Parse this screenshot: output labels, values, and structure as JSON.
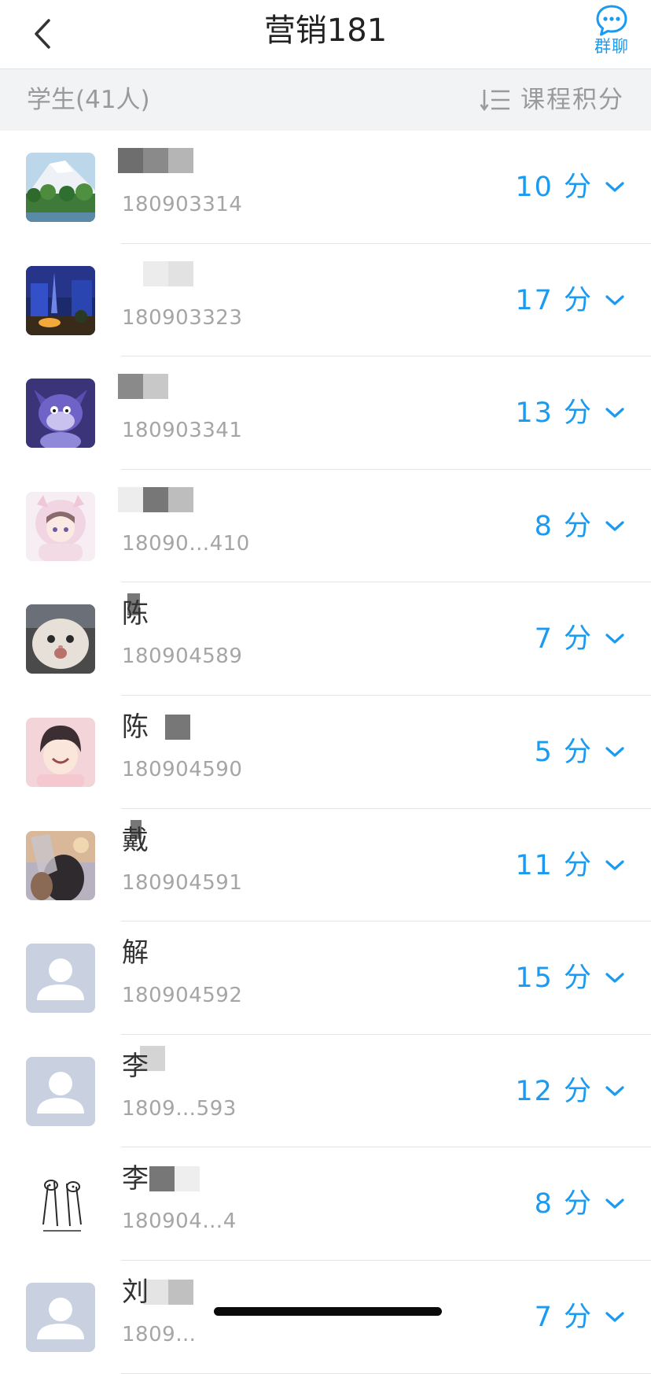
{
  "nav": {
    "title": "营销181",
    "chat_label": "群聊"
  },
  "subheader": {
    "count_label": "学生(41人)",
    "sort_label": "课程积分"
  },
  "students": [
    {
      "name": "",
      "id": "180903314",
      "score": "10 分",
      "avatar": "mountain"
    },
    {
      "name": "",
      "id": "180903323",
      "score": "17 分",
      "avatar": "night-city"
    },
    {
      "name": "",
      "id": "180903341",
      "score": "13 分",
      "avatar": "cartoon-cat"
    },
    {
      "name": "",
      "id": "18090…410",
      "score": "8 分",
      "avatar": "anime-girl"
    },
    {
      "name": "陈",
      "id": "180904589",
      "score": "7 分",
      "avatar": "kitten"
    },
    {
      "name": "陈",
      "id": "180904590",
      "score": "5 分",
      "avatar": "anime-boy"
    },
    {
      "name": "戴",
      "id": "180904591",
      "score": "11 分",
      "avatar": "person-sky"
    },
    {
      "name": "解",
      "id": "180904592",
      "score": "15 分",
      "avatar": "default"
    },
    {
      "name": "李",
      "id": "1809…593",
      "score": "12 分",
      "avatar": "default"
    },
    {
      "name": "李",
      "id": "180904…4",
      "score": "8 分",
      "avatar": "sketch"
    },
    {
      "name": "刘",
      "id": "1809…",
      "score": "7 分",
      "avatar": "default"
    }
  ]
}
